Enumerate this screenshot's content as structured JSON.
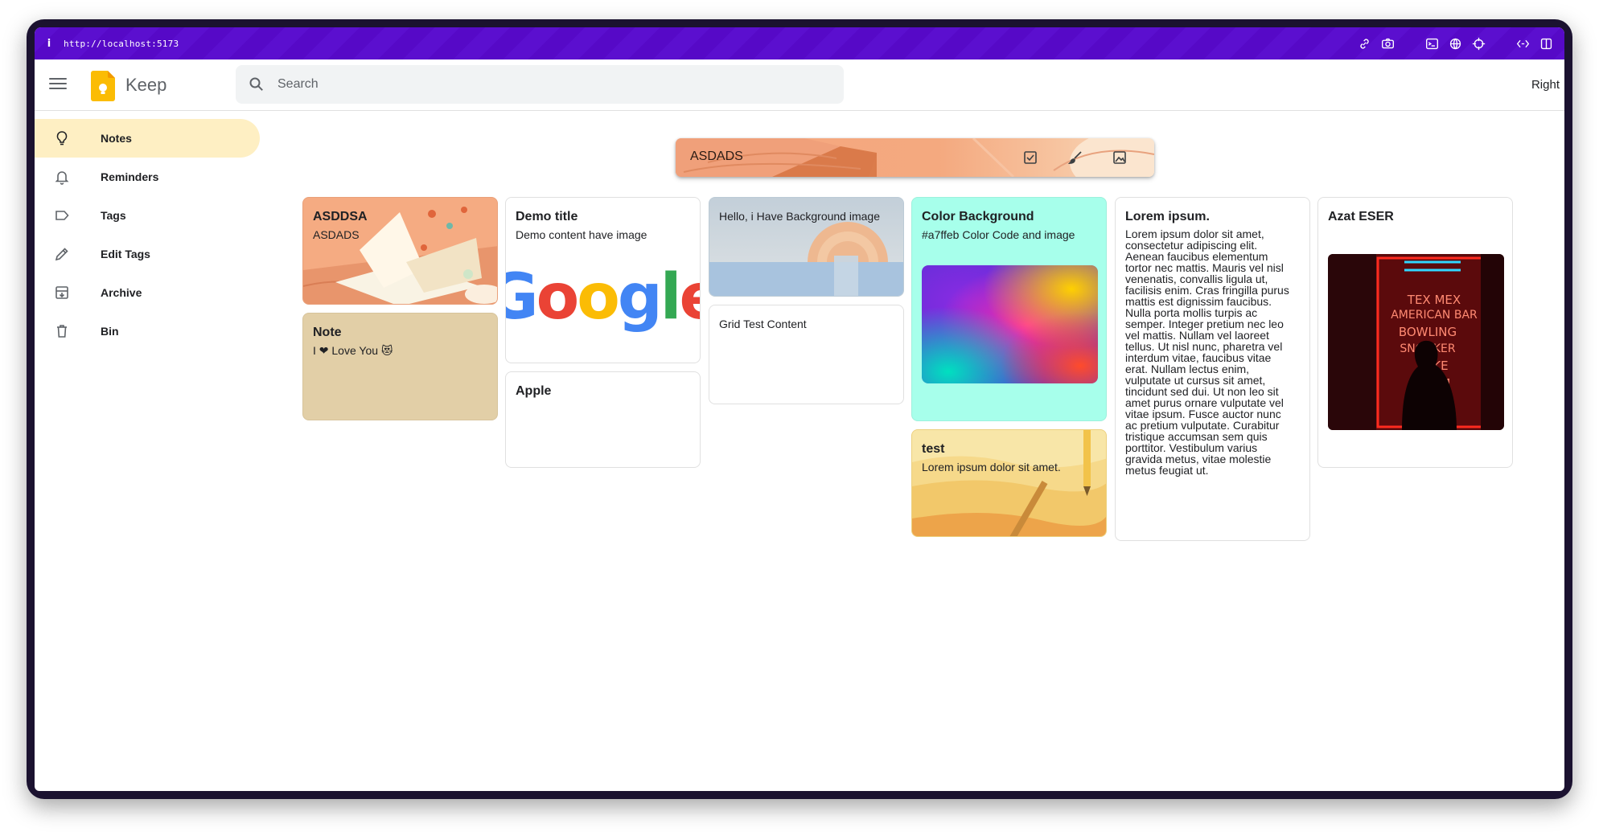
{
  "browser": {
    "url": "http://localhost:5173",
    "info_glyph": "i",
    "toolbar_icons": [
      "link-icon",
      "camera-icon",
      "terminal-icon",
      "globe-icon",
      "crosshair-icon",
      "code-icon",
      "split-view-icon"
    ]
  },
  "header": {
    "app_name": "Keep",
    "search_placeholder": "Search",
    "right_label": "Right"
  },
  "sidebar": {
    "items": [
      {
        "label": "Notes",
        "icon": "lightbulb-icon",
        "active": true
      },
      {
        "label": "Reminders",
        "icon": "bell-icon",
        "active": false
      },
      {
        "label": "Tags",
        "icon": "label-icon",
        "active": false
      },
      {
        "label": "Edit Tags",
        "icon": "pencil-icon",
        "active": false
      },
      {
        "label": "Archive",
        "icon": "archive-icon",
        "active": false
      },
      {
        "label": "Bin",
        "icon": "trash-icon",
        "active": false
      }
    ]
  },
  "composer": {
    "title": "ASDADS",
    "icons": [
      "checkbox-icon",
      "brush-icon",
      "image-icon"
    ]
  },
  "notes": [
    {
      "title": "ASDDSA",
      "body": "ASDADS",
      "background": "illustration"
    },
    {
      "title": "Note",
      "body": "I ❤ Love You 😻",
      "background": "#e2cfa7"
    },
    {
      "title": "Demo title",
      "body": "Demo content have image",
      "image": "google-logo",
      "logo_text": "Google"
    },
    {
      "title": "Apple",
      "body": ""
    },
    {
      "title": "Hello, i Have Background image",
      "body": "",
      "background": "illustration"
    },
    {
      "title": "Grid Test Content",
      "body": ""
    },
    {
      "title": "Color Background",
      "body": "#a7ffeb Color Code and image",
      "background": "#a7ffeb",
      "image": "gradient"
    },
    {
      "title": "test",
      "body": "Lorem ipsum dolor sit amet.",
      "background": "illustration"
    },
    {
      "title": "Lorem ipsum.",
      "body_lines": [
        "Lorem ipsum dolor sit amet,",
        "consectetur adipiscing elit.",
        "Aenean faucibus elementum",
        "tortor nec mattis. Mauris vel nisl",
        "venenatis, convallis ligula ut,",
        "facilisis enim. Cras fringilla purus",
        "mattis est dignissim faucibus.",
        "Nulla porta mollis turpis ac",
        "semper. Integer pretium nec leo",
        "vel mattis. Nullam vel laoreet",
        "tellus. Ut nisl nunc, pharetra vel",
        "interdum vitae, faucibus vitae",
        "erat. Nullam lectus enim,",
        "vulputate ut cursus sit amet,",
        "tincidunt sed dui. Ut non leo sit",
        "amet purus ornare vulputate vel",
        "vitae ipsum. Fusce auctor nunc",
        "ac pretium vulputate. Curabitur",
        "tristique accumsan sem quis",
        "porttitor. Vestibulum varius",
        "gravida metus, vitae molestie",
        "metus feugiat ut."
      ]
    },
    {
      "title": "Azat ESER",
      "body": "",
      "image": "neon-bar-photo",
      "neon_lines": [
        "TEX MEX",
        "AMERICAN BAR",
        "BOWLING",
        "SNOOKER",
        "KE",
        "OM"
      ]
    }
  ],
  "colors": {
    "browser_bar": "#5b0fcf",
    "active_nav": "#feefc3",
    "note_teal": "#a7ffeb",
    "note_sand": "#e2cfa7",
    "composer_peach": "#f6a77f"
  }
}
